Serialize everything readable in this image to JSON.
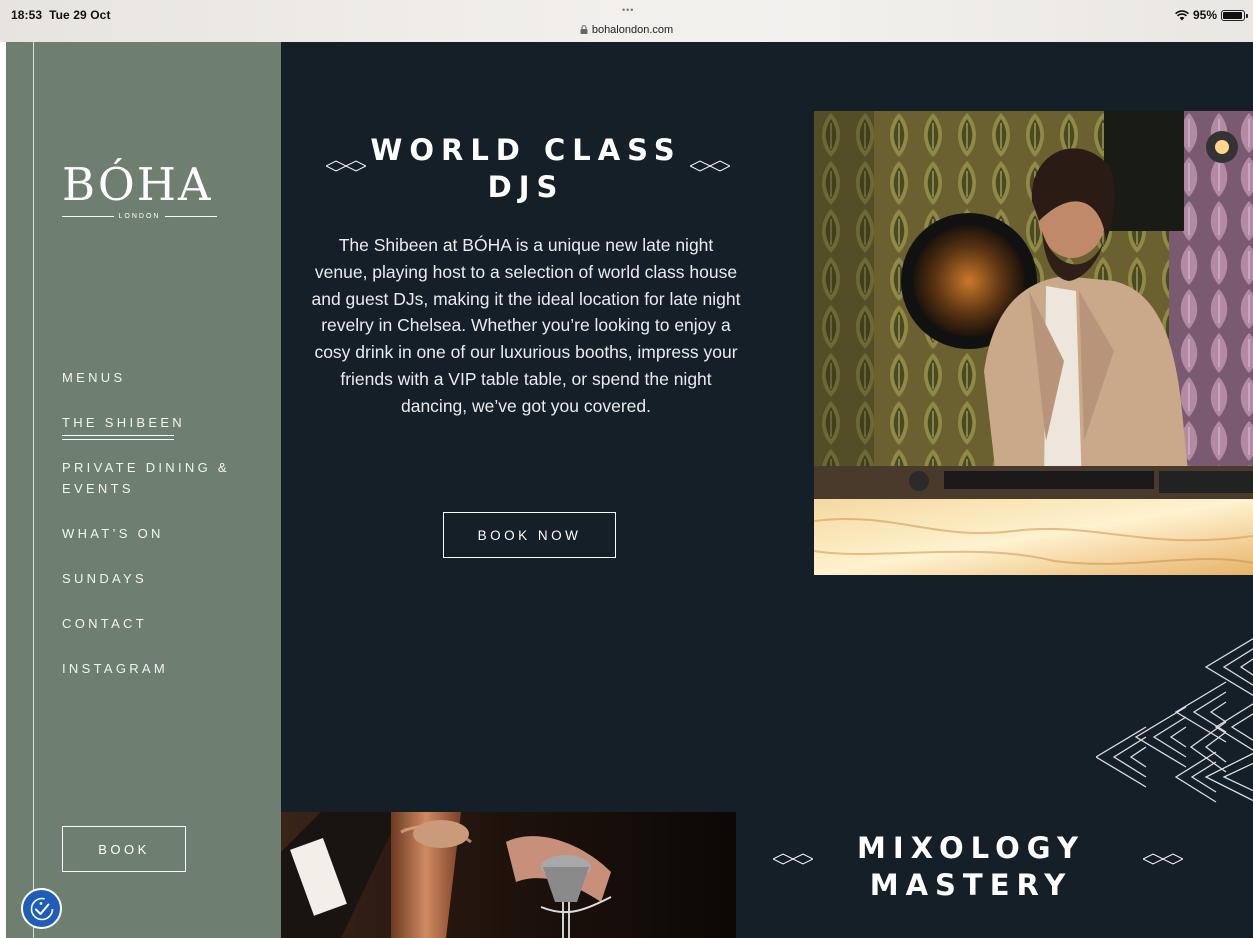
{
  "status_bar": {
    "time": "18:53",
    "date": "Tue 29 Oct",
    "dots": "•••",
    "url": "bohalondon.com",
    "battery": "95%"
  },
  "sidebar": {
    "logo": {
      "word": "BÓHA",
      "sub": "LONDON"
    },
    "nav": [
      {
        "label": "MENUS",
        "active": false
      },
      {
        "label": "THE SHIBEEN",
        "active": true
      },
      {
        "label": "PRIVATE DINING &",
        "label2": "EVENTS",
        "active": false
      },
      {
        "label": "WHAT’S ON",
        "active": false
      },
      {
        "label": "SUNDAYS",
        "active": false
      },
      {
        "label": "CONTACT",
        "active": false
      },
      {
        "label": "INSTAGRAM",
        "active": false
      }
    ],
    "book_label": "BOOK"
  },
  "hero": {
    "heading_line1": "WORLD CLASS",
    "heading_line2": "DJS",
    "body": "The Shibeen at BÓHA is a unique new late night venue, playing host to a selection of world class house and guest DJs, making it the ideal location for late night revelry in Chelsea. Whether you’re looking to enjoy a cosy drink in one of our luxurious booths, impress your friends with a VIP table table, or spend the night dancing, we’ve got you covered.",
    "cta": "BOOK NOW"
  },
  "mixology": {
    "heading_line1": "MIXOLOGY",
    "heading_line2": "MASTERY"
  },
  "colors": {
    "sidebar_bg": "#6f7f6f",
    "page_bg": "#141f27",
    "accessibility_button": "#1f5dbb"
  }
}
